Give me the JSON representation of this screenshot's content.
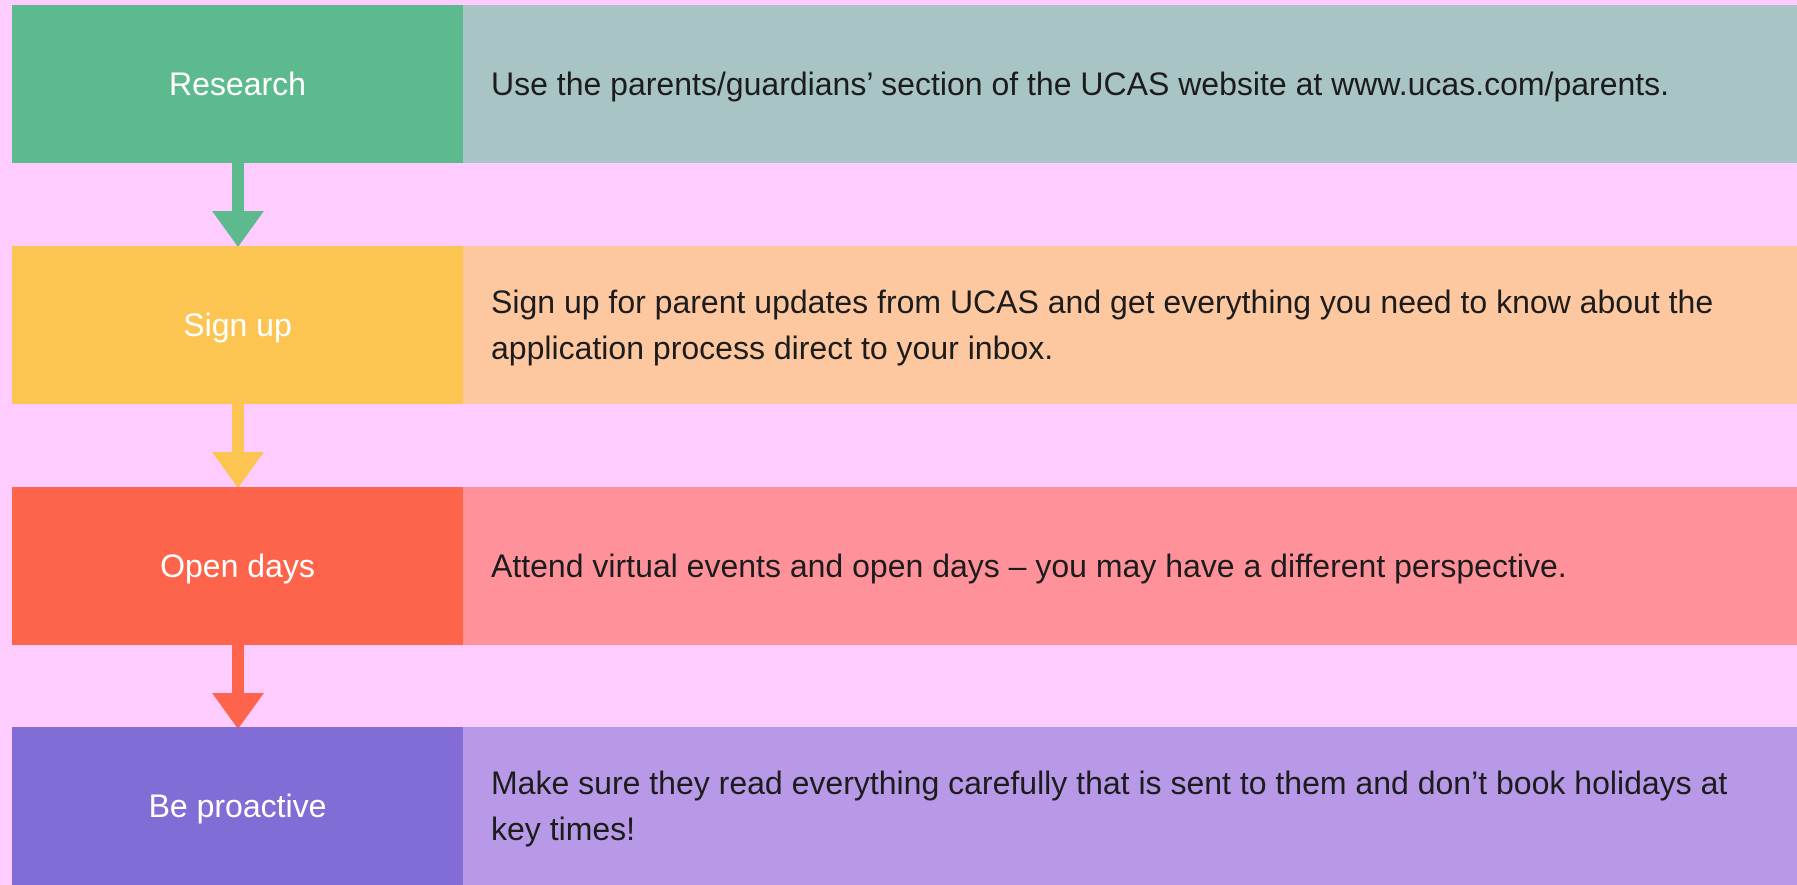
{
  "steps": [
    {
      "label": "Research",
      "description": "Use the parents/guardians’ section of the UCAS website at www.ucas.com/parents.",
      "label_color": "#5dba8e",
      "desc_color": "#a8c4c4",
      "arrow_color": "#5dba8e"
    },
    {
      "label": "Sign up",
      "description": "Sign up for parent updates from UCAS and get everything you need to know about the application process direct to your inbox.",
      "label_color": "#fcc552",
      "desc_color": "#fdc8a0",
      "arrow_color": "#fcc552"
    },
    {
      "label": "Open days",
      "description": "Attend virtual events and open days – you may have a different perspective.",
      "label_color": "#fe644b",
      "desc_color": "#ff919a",
      "arrow_color": "#fe644b"
    },
    {
      "label": "Be proactive",
      "description": "Make sure they read everything carefully that is sent to them and don’t book holidays at key times!",
      "label_color": "#826cd6",
      "desc_color": "#b899e8"
    }
  ]
}
